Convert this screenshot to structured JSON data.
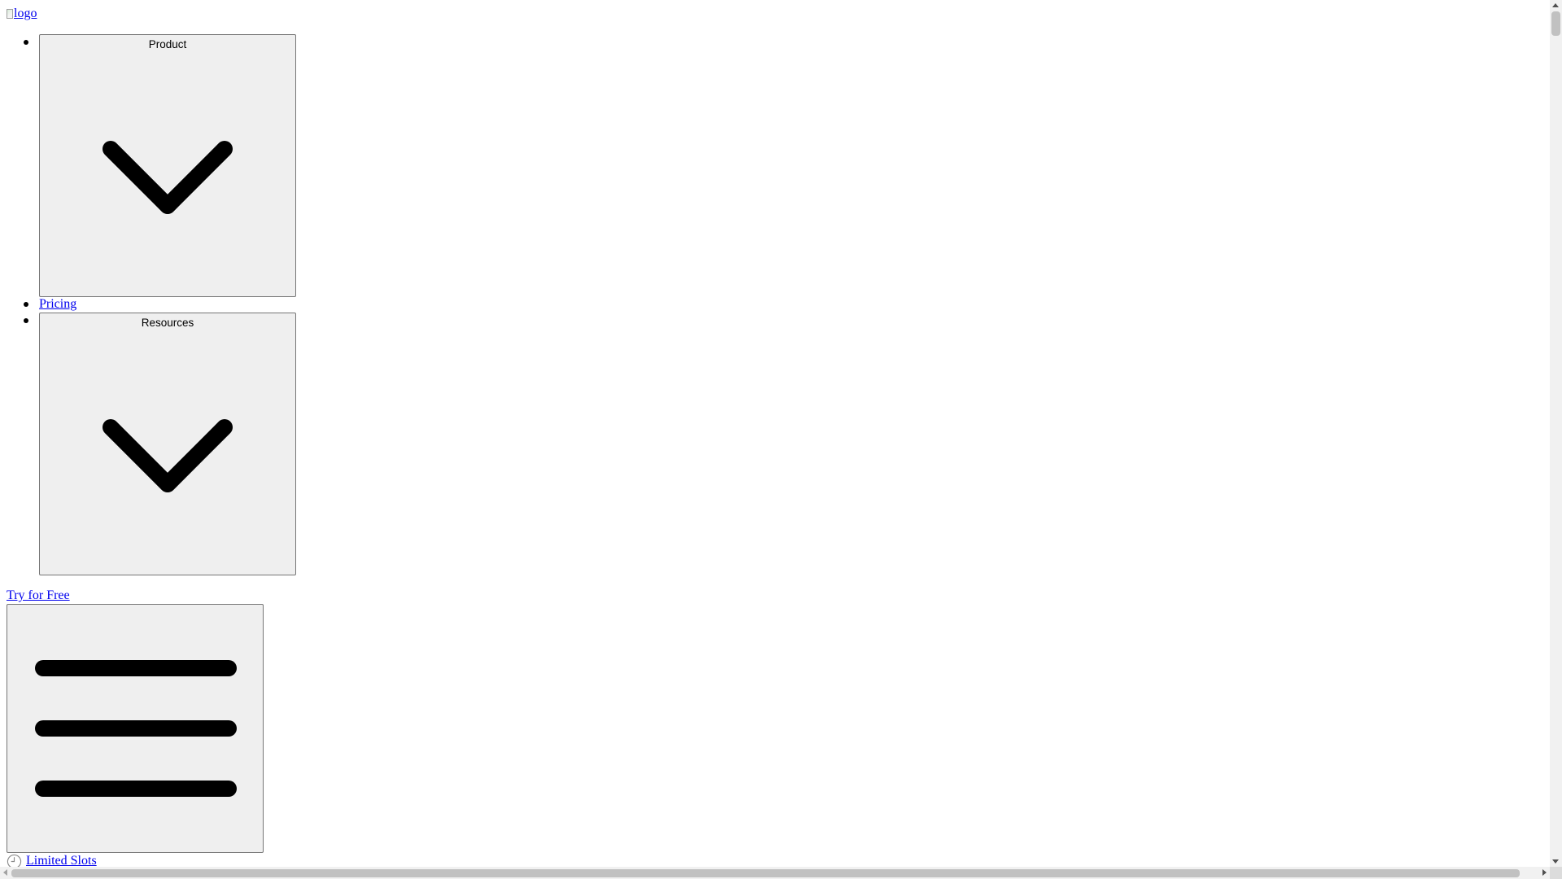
{
  "header": {
    "logo_alt": "logo"
  },
  "nav": {
    "items": [
      {
        "label": "Product",
        "icon": "chevron-down-icon"
      },
      {
        "label": "Pricing"
      },
      {
        "label": "Resources",
        "icon": "chevron-down-icon"
      }
    ]
  },
  "cta": {
    "try_label": "Try for Free"
  },
  "menu_toggle": {
    "icon": "hamburger-menu-icon"
  },
  "banner": {
    "icon": "clock-icon",
    "label": "Limited Slots"
  },
  "colors": {
    "link": "#0000ee",
    "button_bg": "#efefef",
    "button_border": "#767676"
  }
}
